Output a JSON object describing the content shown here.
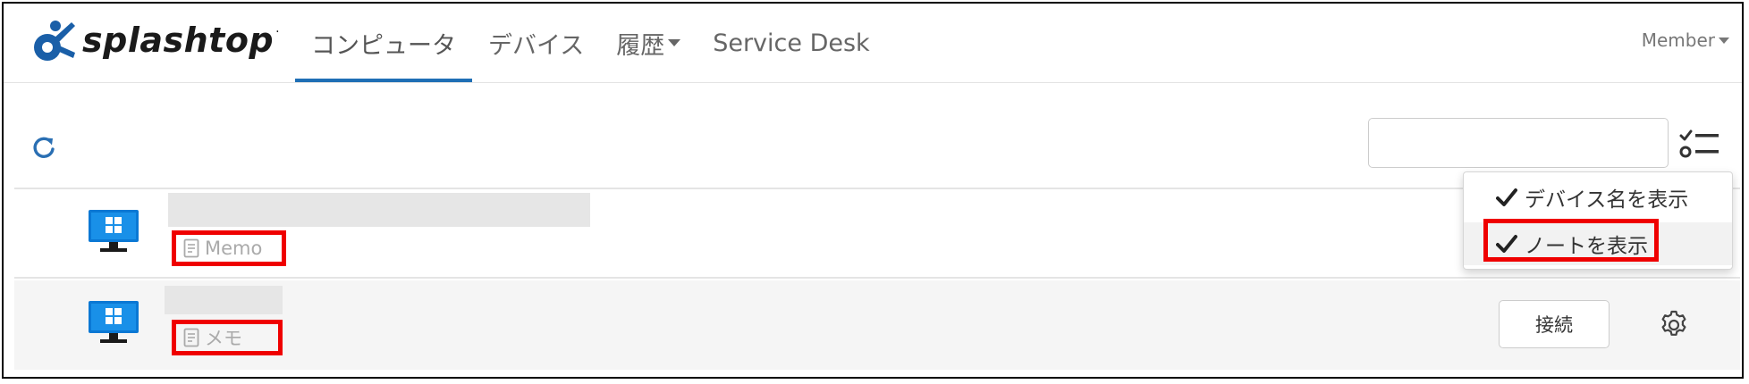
{
  "app": {
    "logo_text": "splashtop",
    "logo_mark": "·"
  },
  "nav": {
    "tabs": [
      {
        "label": "コンピュータ",
        "active": true
      },
      {
        "label": "デバイス",
        "active": false
      },
      {
        "label": "履歴",
        "active": false,
        "has_dropdown": true
      },
      {
        "label": "Service Desk",
        "active": false
      }
    ],
    "member_label": "Member"
  },
  "toolbar": {
    "refresh_icon": "refresh-icon",
    "search_placeholder": "",
    "search_value": "",
    "list_options_icon": "checklist-icon"
  },
  "devices": [
    {
      "os_icon": "windows-monitor-icon",
      "name": "",
      "note": "Memo",
      "show_connect": false
    },
    {
      "os_icon": "windows-monitor-icon",
      "name": "",
      "note": "メモ",
      "show_connect": true,
      "connect_label": "接続"
    }
  ],
  "dropdown": {
    "items": [
      {
        "label": "デバイス名を表示",
        "checked": true
      },
      {
        "label": "ノートを表示",
        "checked": true
      }
    ]
  },
  "colors": {
    "accent": "#1f6fb5",
    "logo_blue": "#1a5fa8",
    "highlight_red": "#ef0000",
    "windows_blue": "#0a78d4"
  }
}
